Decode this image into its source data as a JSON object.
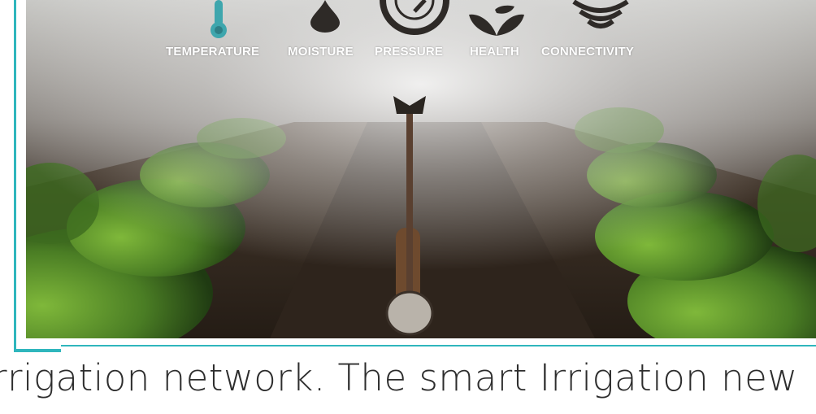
{
  "sensors": [
    {
      "label": "TEMPERATURE",
      "icon": "thermometer-icon"
    },
    {
      "label": "MOISTURE",
      "icon": "water-drop-icon"
    },
    {
      "label": "PRESSURE",
      "icon": "gauge-icon"
    },
    {
      "label": "HEALTH",
      "icon": "leaf-icon"
    },
    {
      "label": "CONNECTIVITY",
      "icon": "wifi-icon"
    }
  ],
  "caption": "rrigation network. The smart Irrigation new",
  "colors": {
    "frame": "#2fb6bd",
    "icon_dark": "#2e2a27",
    "plant_green": "#4e8a2a",
    "soil": "#2b241d"
  }
}
